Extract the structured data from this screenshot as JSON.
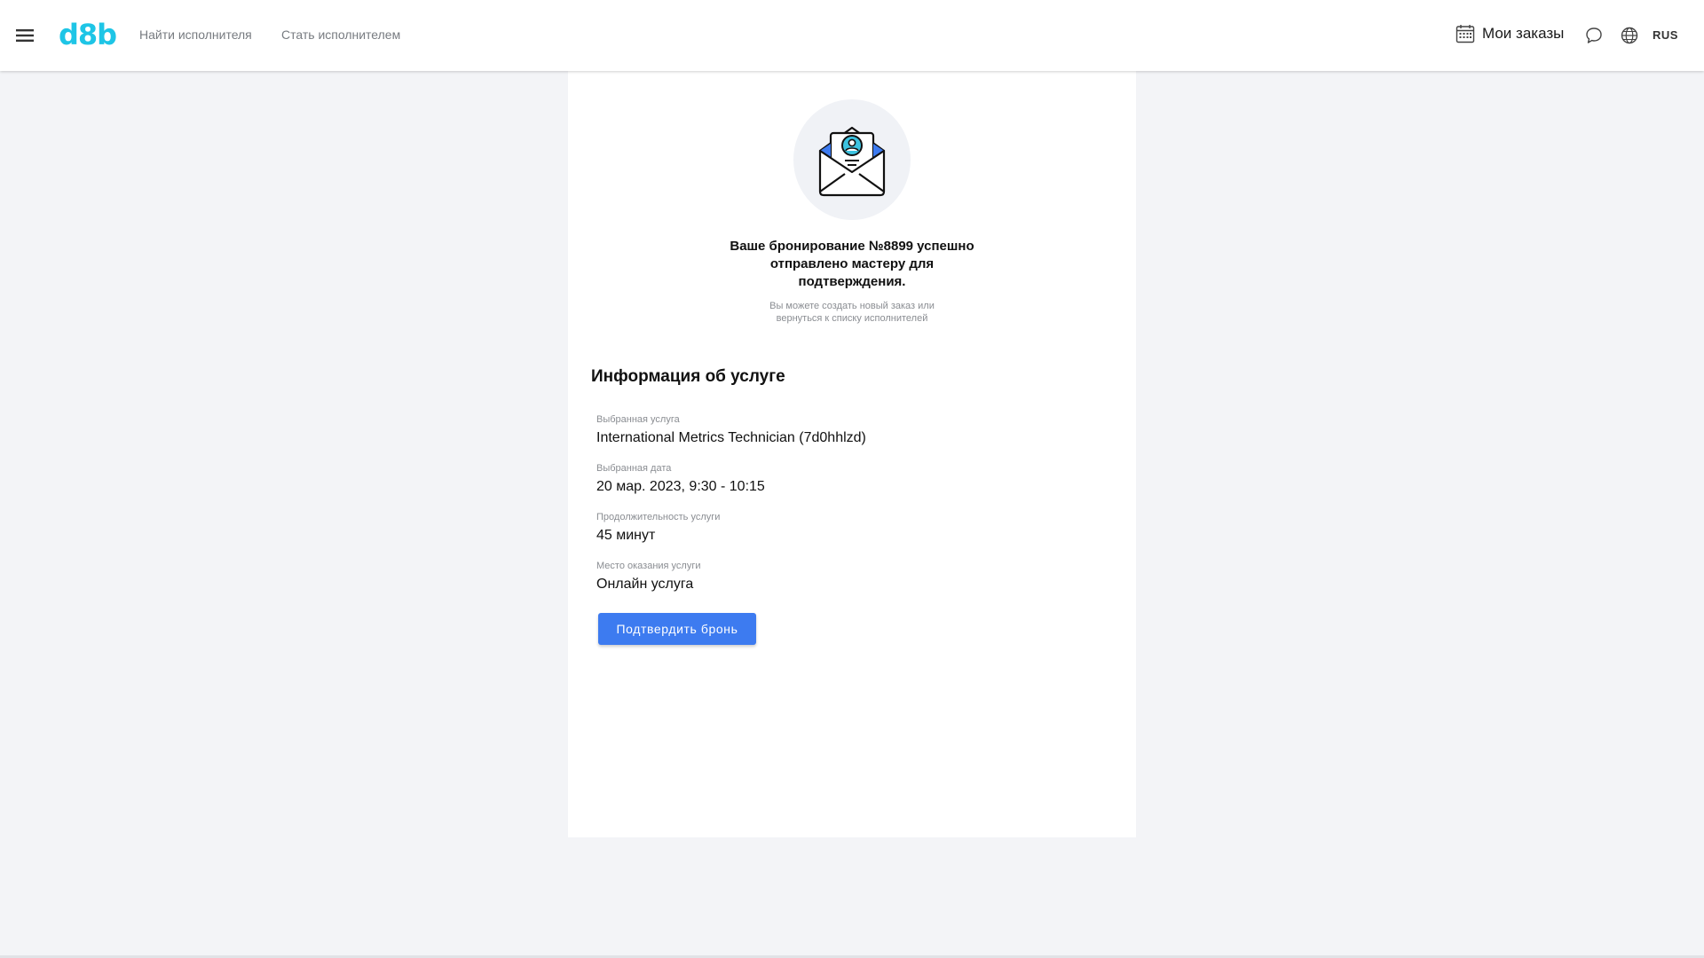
{
  "header": {
    "logo": "d8b",
    "nav": {
      "find_performer": "Найти исполнителя",
      "become_performer": "Стать исполнителем"
    },
    "orders_label": "Мои заказы",
    "language": "RUS",
    "icons": [
      "menu-icon",
      "calendar-icon",
      "chat-icon",
      "globe-icon"
    ]
  },
  "confirmation": {
    "title": "Ваше бронирование №8899 успешно отправлено мастеру для подтверждения.",
    "subtitle": "Вы можете создать новый заказ или вернуться к списку исполнителей"
  },
  "service_info": {
    "title": "Информация об услуге",
    "fields": [
      {
        "label": "Выбранная услуга",
        "value": "International Metrics Technician (7d0hhlzd)"
      },
      {
        "label": "Выбранная дата",
        "value": "20 мар. 2023, 9:30 - 10:15"
      },
      {
        "label": "Продолжительность услуги",
        "value": "45 минут"
      },
      {
        "label": "Место оказания услуги",
        "value": "Онлайн услуга"
      }
    ],
    "confirm_button": "Подтвердить бронь"
  },
  "colors": {
    "brand": "#1ec5e6",
    "primary_button": "#3d7bf0",
    "background": "#f3f4f7"
  }
}
